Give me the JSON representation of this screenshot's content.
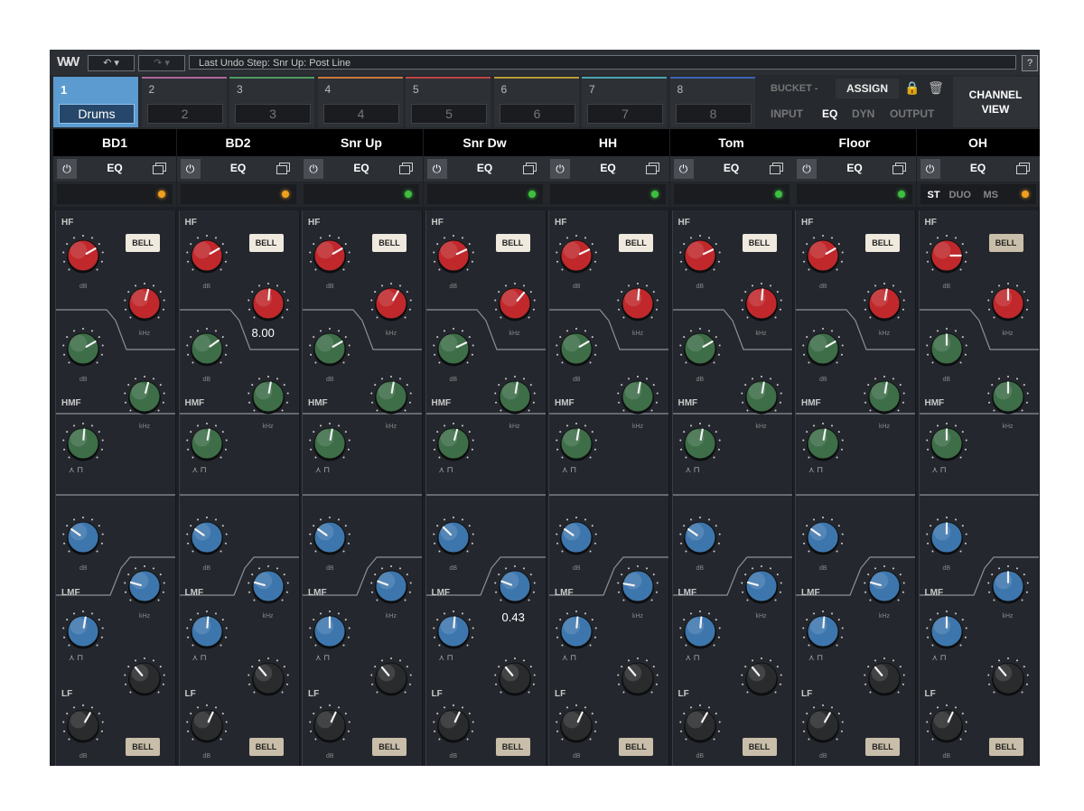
{
  "toolbar": {
    "logo": "WW",
    "undo_icon": "undo-icon",
    "undo_dropdown": "▾",
    "redo_icon": "redo-icon",
    "undo_text": "Last Undo Step:   Snr Up: Post Line",
    "help": "?"
  },
  "groups": [
    {
      "num": "1",
      "label": "Drums",
      "color": "#5b9bd0"
    },
    {
      "num": "2",
      "label": "2",
      "color": "#b0679b"
    },
    {
      "num": "3",
      "label": "3",
      "color": "#4e9a63"
    },
    {
      "num": "4",
      "label": "4",
      "color": "#c8793c"
    },
    {
      "num": "5",
      "label": "5",
      "color": "#c04444"
    },
    {
      "num": "6",
      "label": "6",
      "color": "#b89a3a"
    },
    {
      "num": "7",
      "label": "7",
      "color": "#4aa5b0"
    },
    {
      "num": "8",
      "label": "8",
      "color": "#3d63b8"
    }
  ],
  "bucket": {
    "label": "BUCKET -",
    "assign": "ASSIGN",
    "lock_icon": "lock-icon",
    "trash_icon": "trash-icon",
    "modes": [
      "INPUT",
      "EQ",
      "DYN",
      "OUTPUT"
    ],
    "active_mode": "EQ"
  },
  "channel_view": {
    "line1": "CHANNEL",
    "line2": "VIEW"
  },
  "channels": [
    {
      "name": "BD1",
      "led": "#f0a020"
    },
    {
      "name": "BD2",
      "led": "#f0a020"
    },
    {
      "name": "Snr Up",
      "led": "#3fbf3f"
    },
    {
      "name": "Snr Dw",
      "led": "#3fbf3f"
    },
    {
      "name": "HH",
      "led": "#3fbf3f"
    },
    {
      "name": "Tom",
      "led": "#3fbf3f"
    },
    {
      "name": "Floor",
      "led": "#3fbf3f"
    },
    {
      "name": "OH",
      "led": "#f0a020"
    }
  ],
  "strip": {
    "eq_label": "EQ",
    "power_icon": "⏻",
    "hf": "HF",
    "hmf": "HMF",
    "lmf": "LMF",
    "lf": "LF",
    "db": "dB",
    "khz": "kHz",
    "bell": "BELL",
    "q_shapes": "⋏ ⊓"
  },
  "oh_modes": [
    "ST",
    "DUO",
    "MS"
  ],
  "oh_active_mode": "ST",
  "readouts": {
    "bd2_hf_freq": "8.00",
    "snrdw_lmf_freq": "0.43"
  },
  "colors": {
    "red": "#c0282c",
    "green": "#3d6e48",
    "blue": "#3d76ad",
    "black": "#2a2b2d"
  }
}
